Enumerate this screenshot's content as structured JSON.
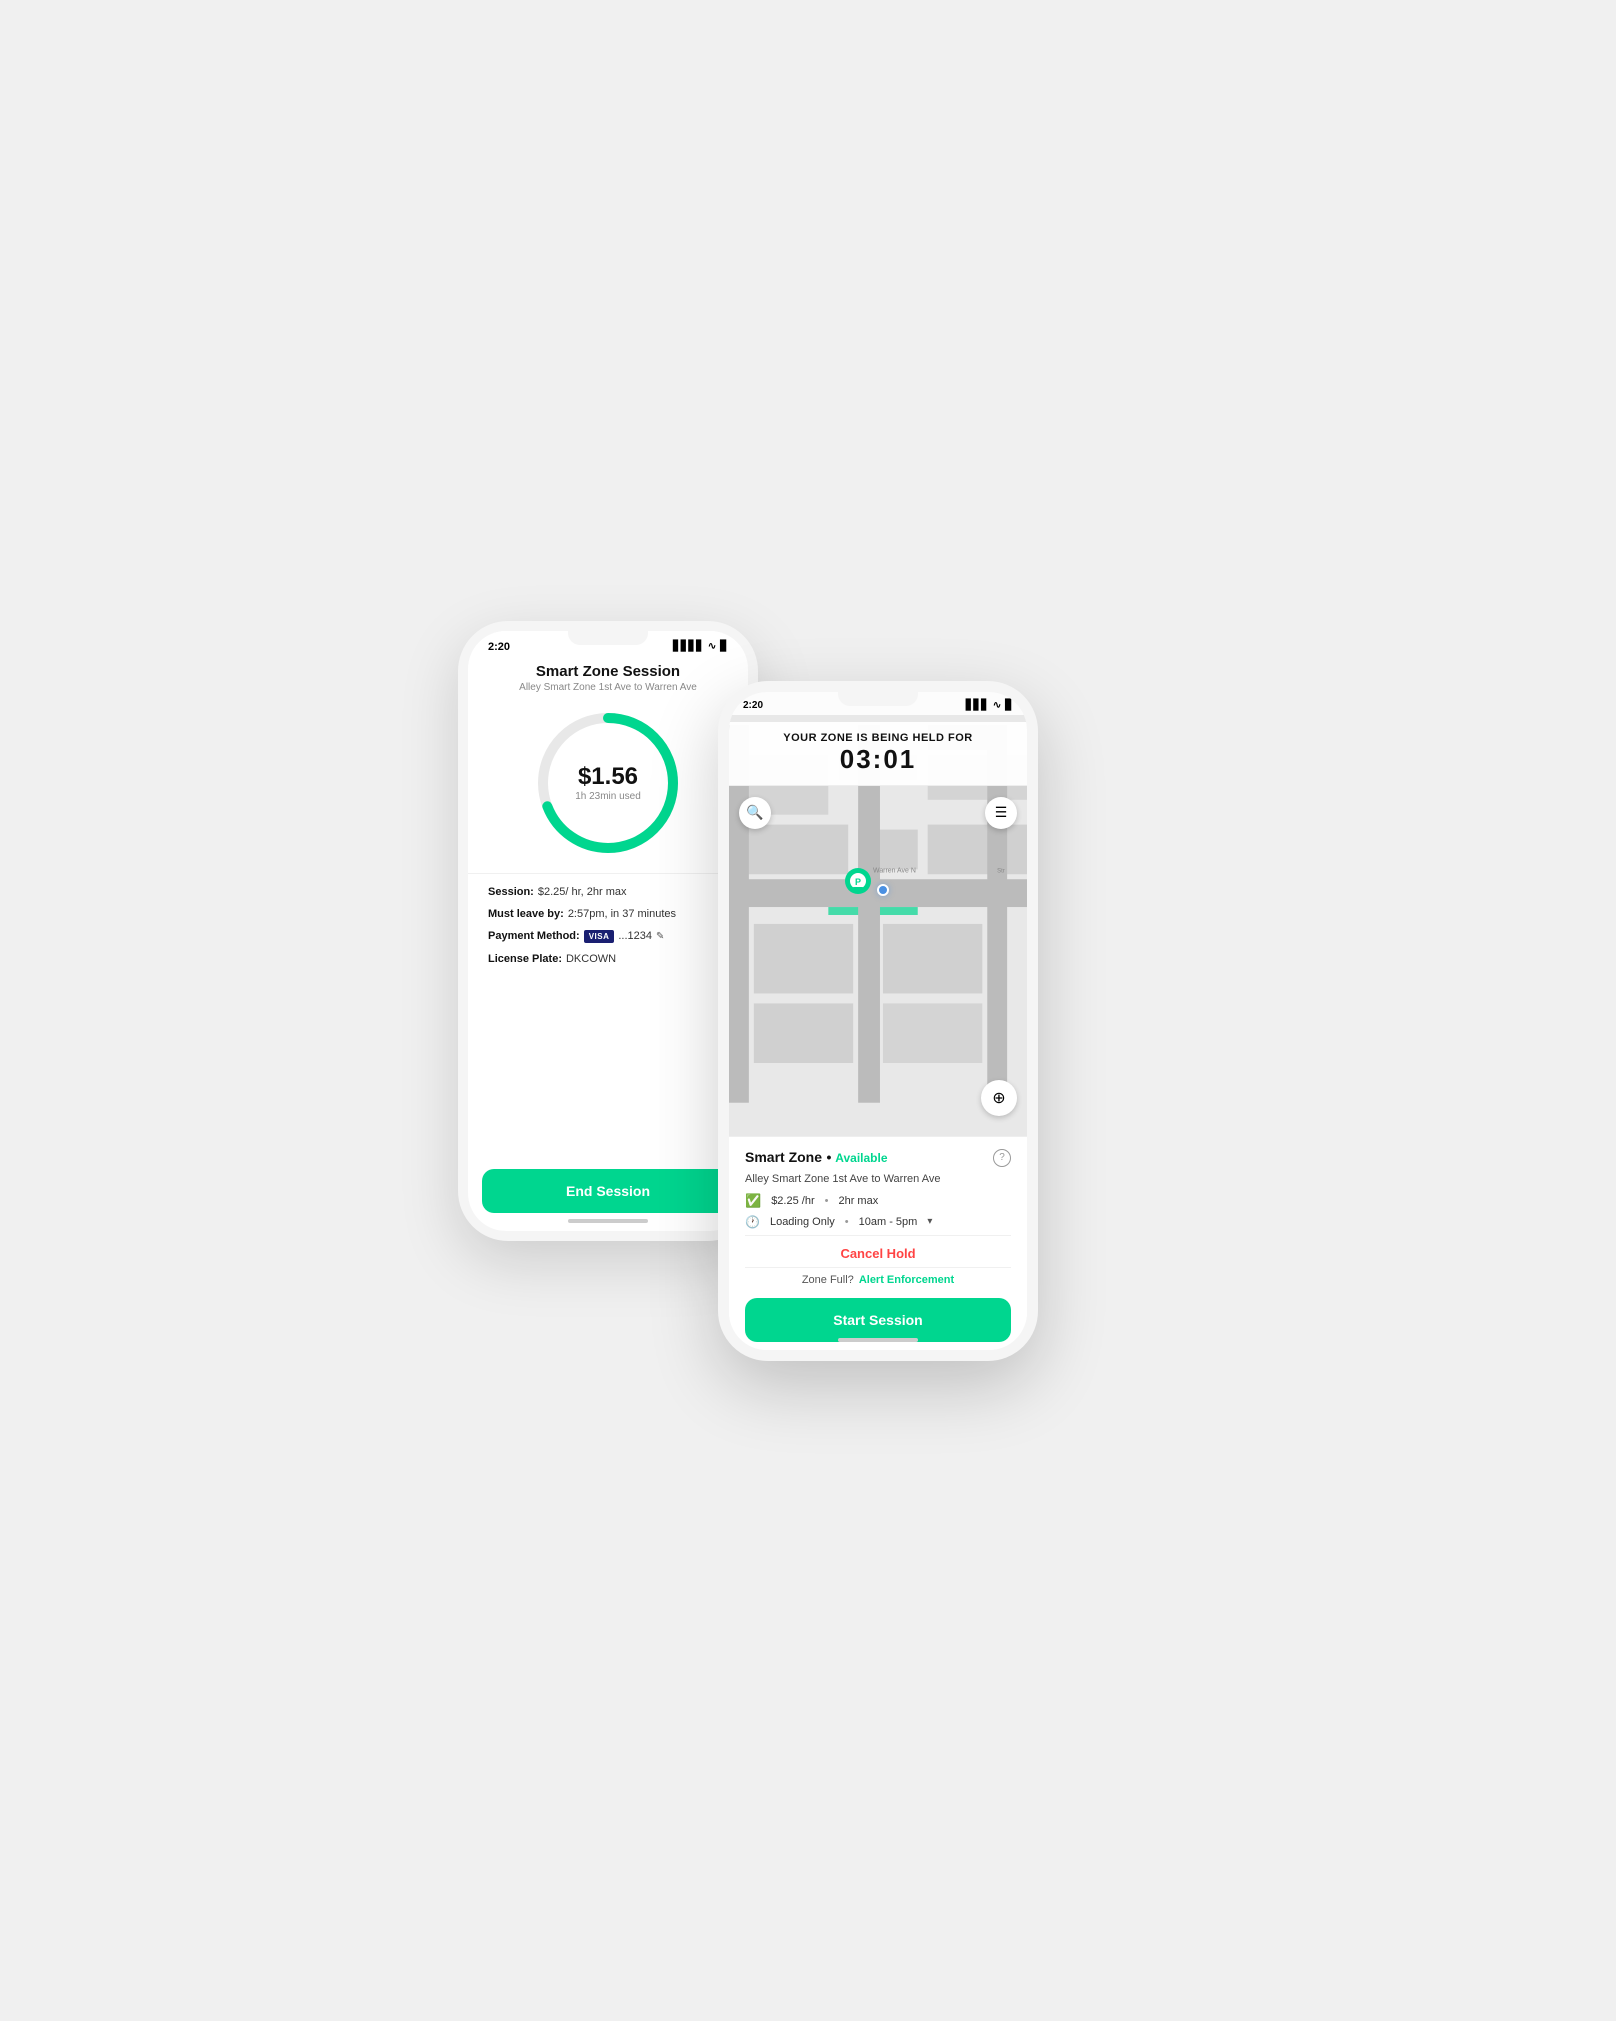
{
  "scene": {
    "background": "#f0f0f0"
  },
  "left_phone": {
    "status_bar": {
      "time": "2:20",
      "signal": "▋▋▋▋",
      "wifi": "wifi",
      "battery": "battery"
    },
    "title": "Smart Zone Session",
    "subtitle": "Alley Smart Zone 1st Ave to Warren Ave",
    "amount": "$1.56",
    "time_used": "1h 23min used",
    "progress_pct": 69,
    "session_info": "$2.25/ hr, 2hr max",
    "must_leave": "2:57pm, in 37 minutes",
    "payment_label": "Payment Method:",
    "payment_card": "...1234",
    "license_label": "License Plate:",
    "license_value": "DKCOWN",
    "session_label": "Session:",
    "must_leave_label": "Must leave by:",
    "end_session_btn": "End Session",
    "visa_label": "VISA"
  },
  "right_phone": {
    "status_bar": {
      "time": "2:20",
      "signal": "▋▋▋",
      "wifi": "wifi",
      "battery": "battery"
    },
    "hold_banner": {
      "label": "YOUR ZONE IS BEING HELD FOR",
      "timer": "03:01"
    },
    "search_icon": "search",
    "menu_icon": "menu",
    "compass_icon": "compass",
    "bottom_panel": {
      "zone_name_prefix": "Smart Zone",
      "zone_sep": "•",
      "zone_status": "Available",
      "help": "?",
      "zone_address": "Alley Smart Zone 1st Ave to Warren Ave",
      "price": "$2.25 /hr",
      "bullet": "•",
      "max": "2hr max",
      "restriction": "Loading Only",
      "hours": "10am - 5pm",
      "cancel_hold_btn": "Cancel Hold",
      "zone_full_label": "Zone Full?",
      "alert_link": "Alert Enforcement",
      "start_session_btn": "Start Session"
    }
  }
}
